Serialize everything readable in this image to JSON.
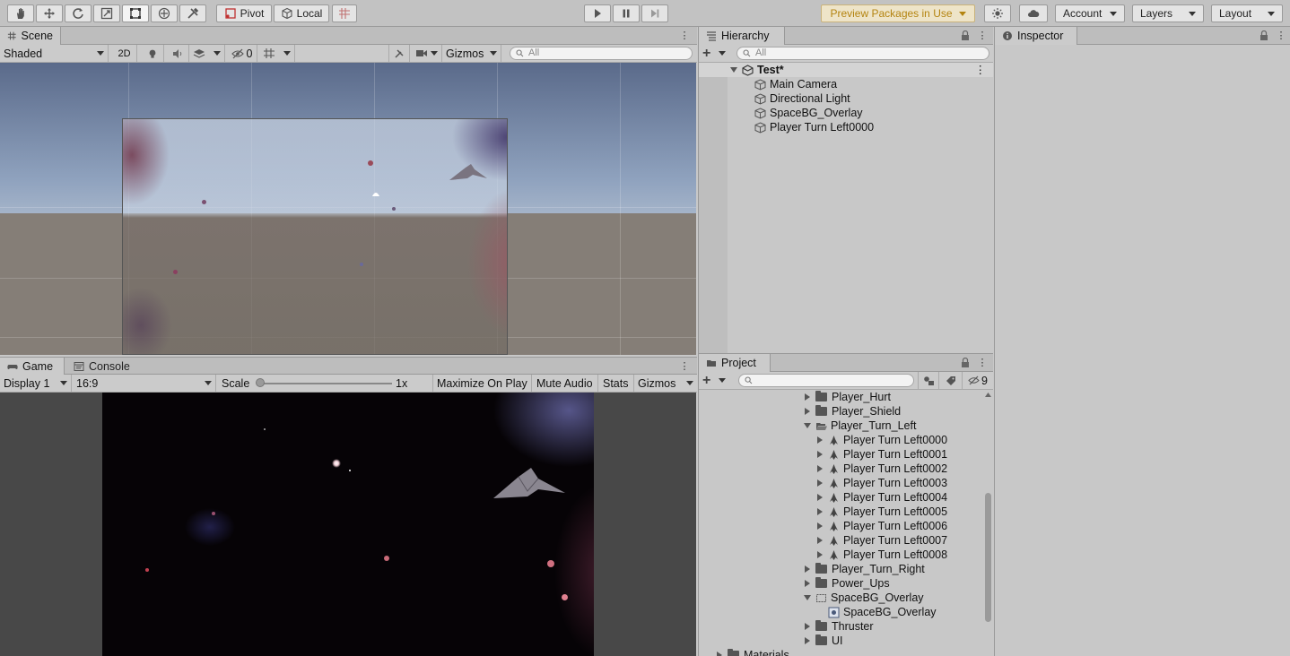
{
  "toolbar": {
    "tools": [
      "hand-tool",
      "move-tool",
      "rotate-tool",
      "scale-tool",
      "rect-tool",
      "transform-tool",
      "custom-tool"
    ],
    "pivot_label": "Pivot",
    "local_label": "Local",
    "preview_packages_label": "Preview Packages in Use",
    "account_label": "Account",
    "layers_label": "Layers",
    "layout_label": "Layout"
  },
  "scene": {
    "tab_label": "Scene",
    "shading_mode": "Shaded",
    "mode_2d": "2D",
    "hidden_count": "0",
    "gizmos_label": "Gizmos",
    "search_placeholder": "All"
  },
  "game": {
    "tab_label": "Game",
    "console_tab_label": "Console",
    "display": "Display 1",
    "aspect": "16:9",
    "scale_label": "Scale",
    "scale_value": "1x",
    "maximize_label": "Maximize On Play",
    "mute_label": "Mute Audio",
    "stats_label": "Stats",
    "gizmos_label": "Gizmos"
  },
  "hierarchy": {
    "tab_label": "Hierarchy",
    "search_placeholder": "All",
    "scene_name": "Test*",
    "items": [
      "Main Camera",
      "Directional Light",
      "SpaceBG_Overlay",
      "Player Turn Left0000"
    ]
  },
  "inspector": {
    "tab_label": "Inspector"
  },
  "project": {
    "tab_label": "Project",
    "hidden_count": "9",
    "items": [
      {
        "label": "Player_Hurt",
        "type": "folder",
        "state": "collapsed"
      },
      {
        "label": "Player_Shield",
        "type": "folder",
        "state": "collapsed"
      },
      {
        "label": "Player_Turn_Left",
        "type": "folder-open",
        "state": "expanded"
      },
      {
        "label": "Player Turn Left0000",
        "type": "sprite",
        "state": "collapsed"
      },
      {
        "label": "Player Turn Left0001",
        "type": "sprite",
        "state": "collapsed"
      },
      {
        "label": "Player Turn Left0002",
        "type": "sprite",
        "state": "collapsed"
      },
      {
        "label": "Player Turn Left0003",
        "type": "sprite",
        "state": "collapsed"
      },
      {
        "label": "Player Turn Left0004",
        "type": "sprite",
        "state": "collapsed"
      },
      {
        "label": "Player Turn Left0005",
        "type": "sprite",
        "state": "collapsed"
      },
      {
        "label": "Player Turn Left0006",
        "type": "sprite",
        "state": "collapsed"
      },
      {
        "label": "Player Turn Left0007",
        "type": "sprite",
        "state": "collapsed"
      },
      {
        "label": "Player Turn Left0008",
        "type": "sprite",
        "state": "collapsed"
      },
      {
        "label": "Player_Turn_Right",
        "type": "folder",
        "state": "collapsed"
      },
      {
        "label": "Power_Ups",
        "type": "folder",
        "state": "collapsed"
      },
      {
        "label": "SpaceBG_Overlay",
        "type": "texture",
        "state": "expanded"
      },
      {
        "label": "SpaceBG_Overlay",
        "type": "sprite-child",
        "state": "none"
      },
      {
        "label": "Thruster",
        "type": "folder",
        "state": "collapsed"
      },
      {
        "label": "UI",
        "type": "folder",
        "state": "collapsed"
      },
      {
        "label": "Materials",
        "type": "folder",
        "state": "collapsed"
      }
    ]
  },
  "colors": {
    "preview_text": "#b48410",
    "panel_bg": "#c8c8c8",
    "tab_bg": "#bdbdbd"
  }
}
